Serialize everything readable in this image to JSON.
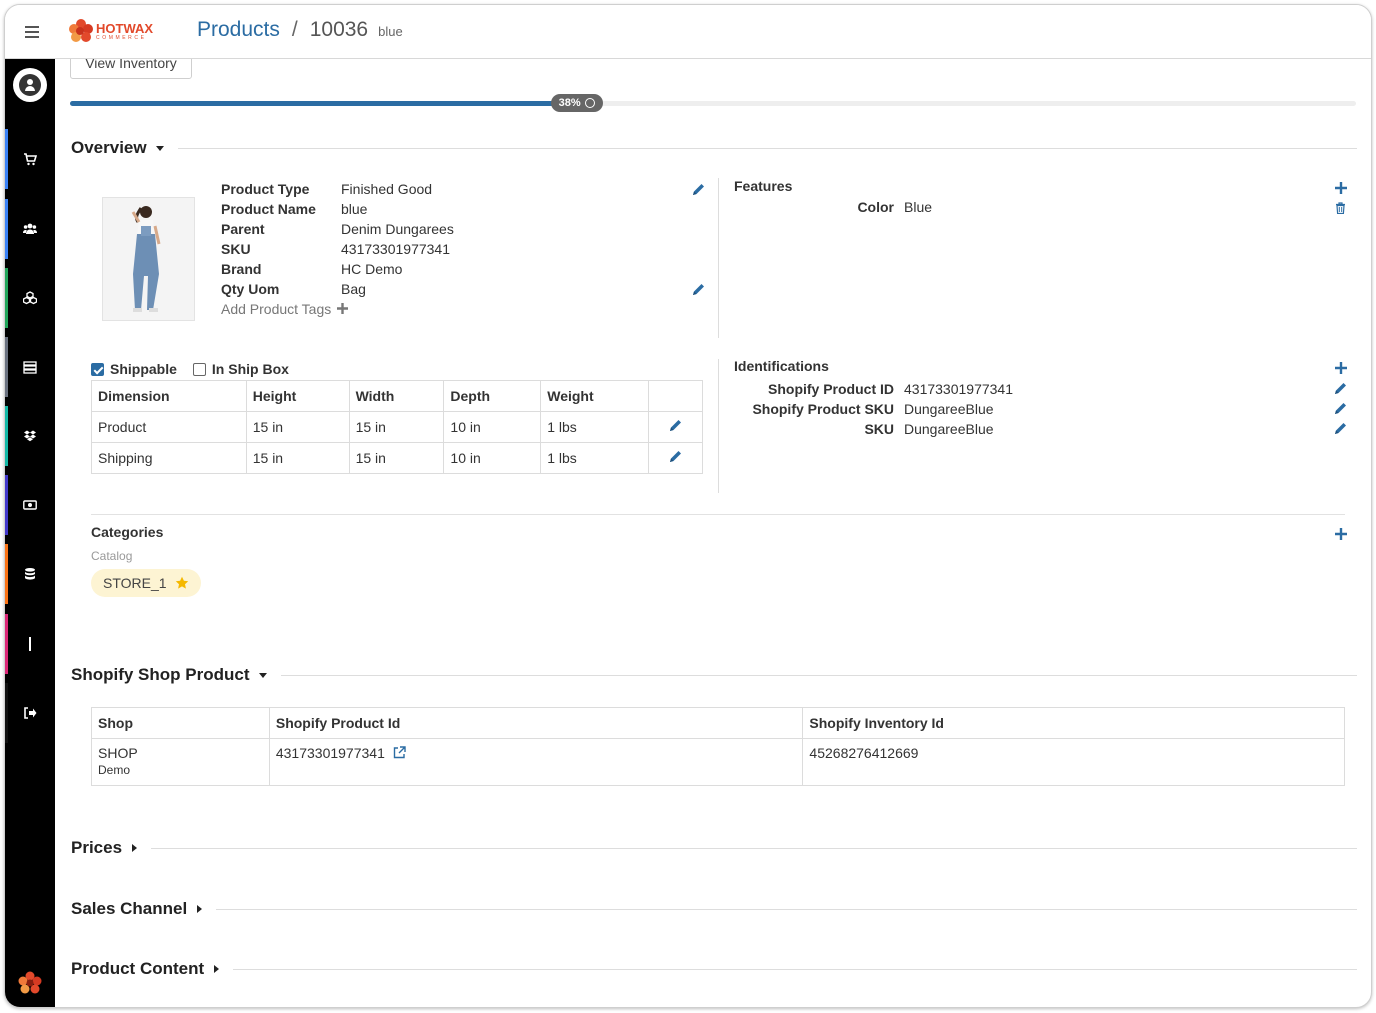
{
  "header": {
    "logo_text": "HOTWAX",
    "logo_sub": "COMMERCE",
    "breadcrumb_root": "Products",
    "breadcrumb_sep": "/",
    "breadcrumb_id": "10036",
    "breadcrumb_name": "blue"
  },
  "toolbar": {
    "view_inventory": "View Inventory"
  },
  "progress": {
    "percent": 38,
    "label": "38%"
  },
  "overview": {
    "title": "Overview",
    "fields": [
      {
        "key": "Product Type",
        "value": "Finished Good"
      },
      {
        "key": "Product Name",
        "value": "blue"
      },
      {
        "key": "Parent",
        "value": "Denim Dungarees"
      },
      {
        "key": "SKU",
        "value": "43173301977341"
      },
      {
        "key": "Brand",
        "value": "HC Demo"
      },
      {
        "key": "Qty Uom",
        "value": "Bag"
      }
    ],
    "add_tags": "Add Product Tags"
  },
  "features": {
    "title": "Features",
    "items": [
      {
        "key": "Color",
        "value": "Blue"
      }
    ]
  },
  "shipping": {
    "shippable_label": "Shippable",
    "shippable": true,
    "in_ship_box_label": "In Ship Box",
    "in_ship_box": false,
    "columns": [
      "Dimension",
      "Height",
      "Width",
      "Depth",
      "Weight"
    ],
    "rows": [
      [
        "Product",
        "15 in",
        "15 in",
        "10 in",
        "1 lbs"
      ],
      [
        "Shipping",
        "15 in",
        "15 in",
        "10 in",
        "1 lbs"
      ]
    ]
  },
  "identifications": {
    "title": "Identifications",
    "items": [
      {
        "key": "Shopify Product ID",
        "value": "43173301977341"
      },
      {
        "key": "Shopify Product SKU",
        "value": "DungareeBlue"
      },
      {
        "key": "SKU",
        "value": "DungareeBlue"
      }
    ]
  },
  "categories": {
    "title": "Categories",
    "catalog_label": "Catalog",
    "chip": "STORE_1"
  },
  "shopify": {
    "title": "Shopify Shop Product",
    "columns": [
      "Shop",
      "Shopify Product Id",
      "Shopify Inventory Id"
    ],
    "row": {
      "shop": "SHOP",
      "shop_sub": "Demo",
      "product_id": "43173301977341",
      "inventory_id": "45268276412669"
    }
  },
  "sections": {
    "prices": "Prices",
    "sales_channel": "Sales Channel",
    "product_content": "Product Content"
  },
  "colors": {
    "accent": "#2b6ca3",
    "brand": "#e2492b",
    "sidebar_stripes": [
      "#3b82f6",
      "#3b82f6",
      "#22a55a",
      "#6b7280",
      "#14b8a6",
      "#4338ca",
      "#f97316",
      "#db2777",
      "#111111"
    ]
  }
}
